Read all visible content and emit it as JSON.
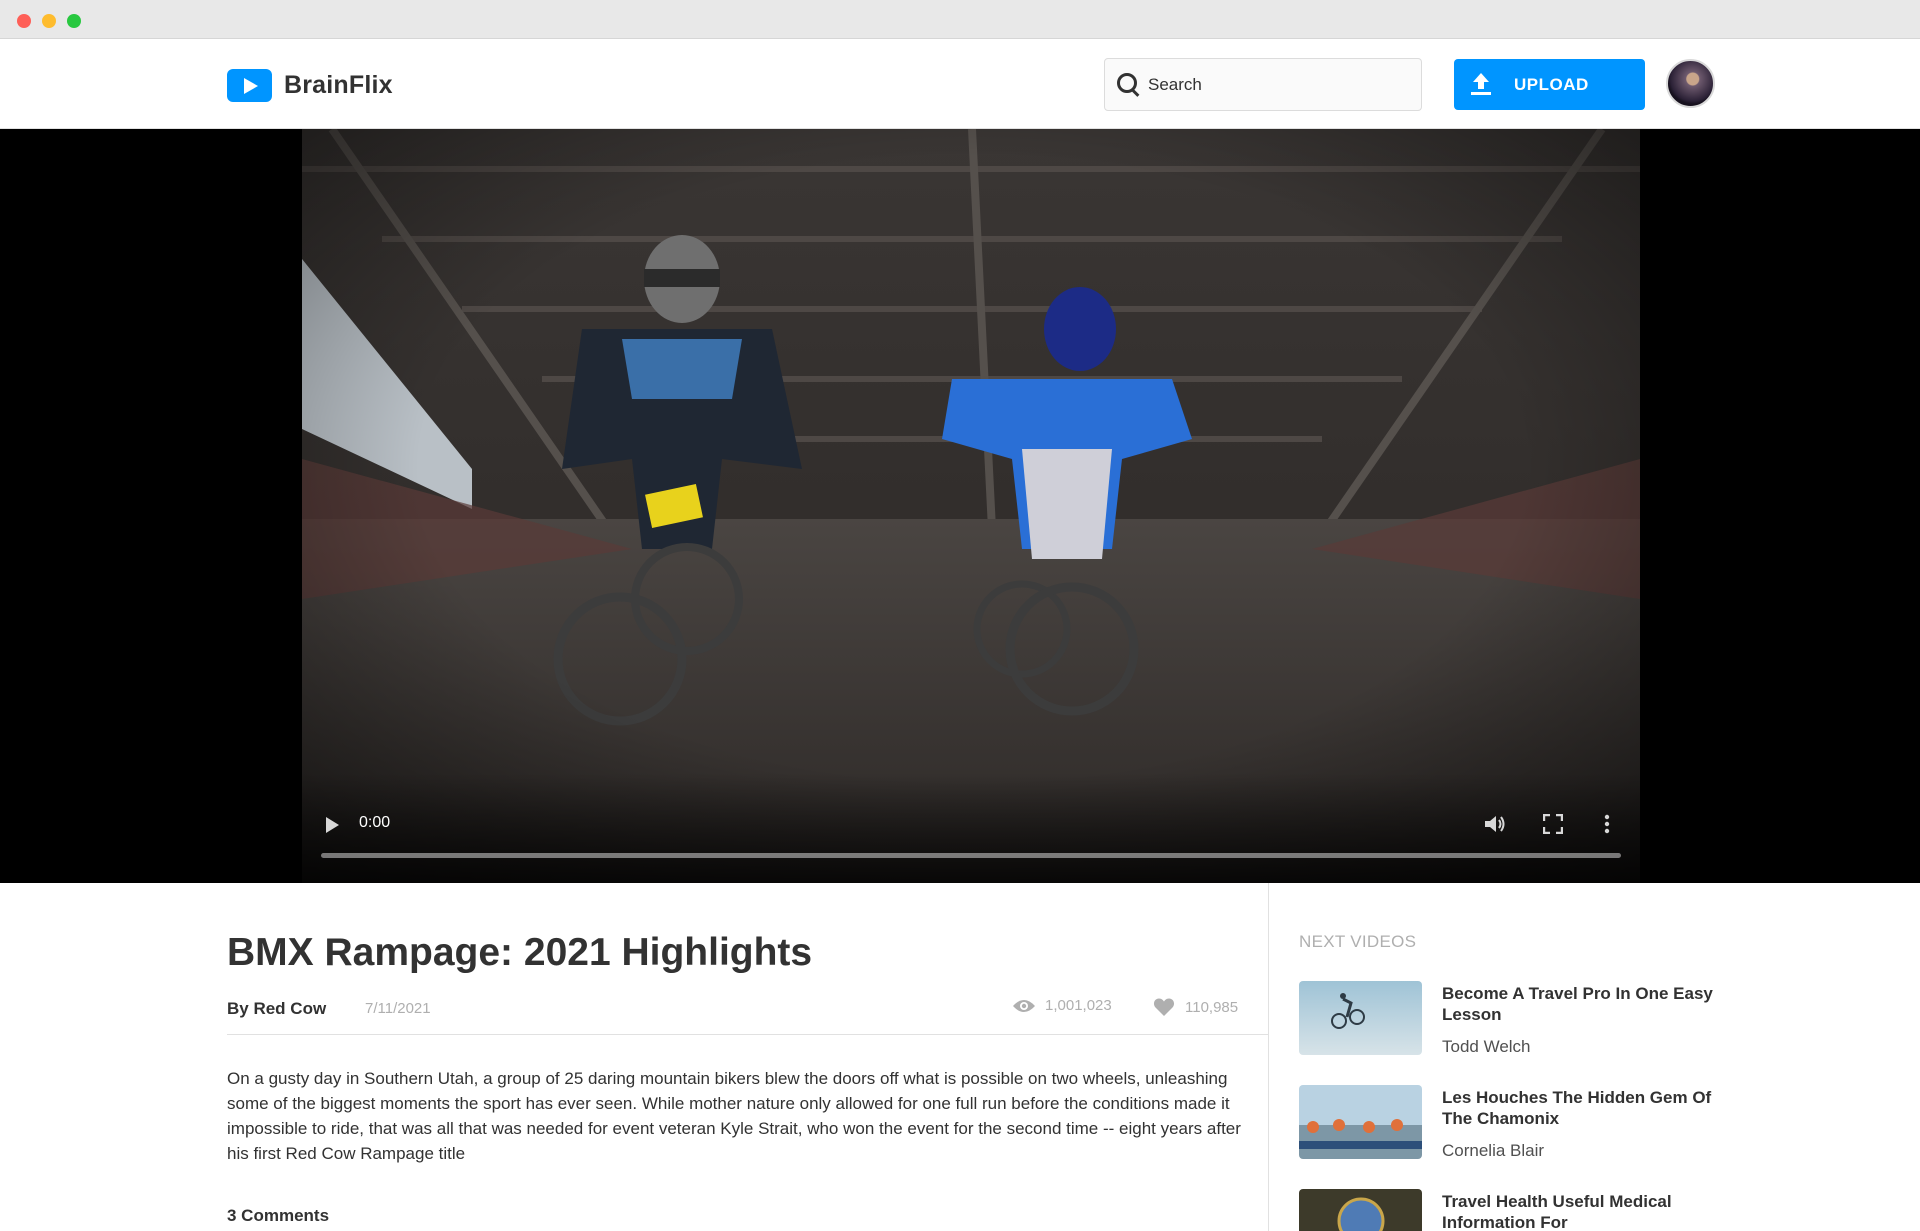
{
  "header": {
    "logo_text": "BrainFlix",
    "search_placeholder": "Search",
    "upload_label": "UPLOAD"
  },
  "player": {
    "current_time": "0:00",
    "progress_fraction": 0
  },
  "video": {
    "title": "BMX Rampage: 2021 Highlights",
    "channel": "By Red Cow",
    "date": "7/11/2021",
    "views": "1,001,023",
    "likes": "110,985",
    "description": "On a gusty day in Southern Utah, a group of 25 daring mountain bikers blew the doors off what is possible on two wheels, unleashing some of the biggest moments the sport has ever seen. While mother nature only allowed for one full run before the conditions made it impossible to ride, that was all that was needed for event veteran Kyle Strait, who won the event for the second time -- eight years after his first Red Cow Rampage title",
    "comments_count": "3 Comments"
  },
  "next_videos": {
    "heading": "NEXT VIDEOS",
    "items": [
      {
        "title": "Become A Travel Pro In One Easy Lesson",
        "channel": "Todd Welch"
      },
      {
        "title": "Les Houches The Hidden Gem Of The Chamonix",
        "channel": "Cornelia Blair"
      },
      {
        "title": "Travel Health Useful Medical Information For",
        "channel": ""
      }
    ]
  },
  "colors": {
    "brand_blue": "#0095ff",
    "text_dark": "#323232",
    "text_muted": "#afafaf",
    "divider": "#e1e1e1"
  }
}
